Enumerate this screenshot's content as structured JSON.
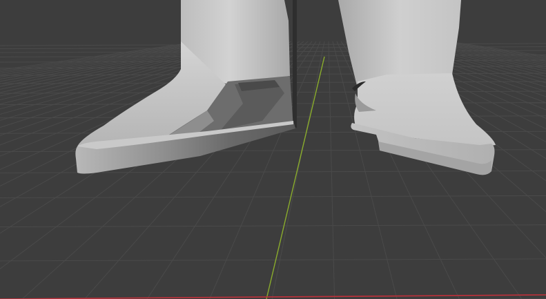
{
  "viewport": {
    "mode": "3d-viewport",
    "shading": "solid",
    "background_color": "#3d3d3d",
    "grid_color": "#4a4a4a",
    "y_axis_color": "#8aac2c",
    "x_axis_color": "#c0303a",
    "mesh_color": "#c8c8c8",
    "grid_visible": true
  },
  "scene": {
    "objects": [
      {
        "name": "left-boot"
      },
      {
        "name": "right-boot"
      }
    ]
  }
}
